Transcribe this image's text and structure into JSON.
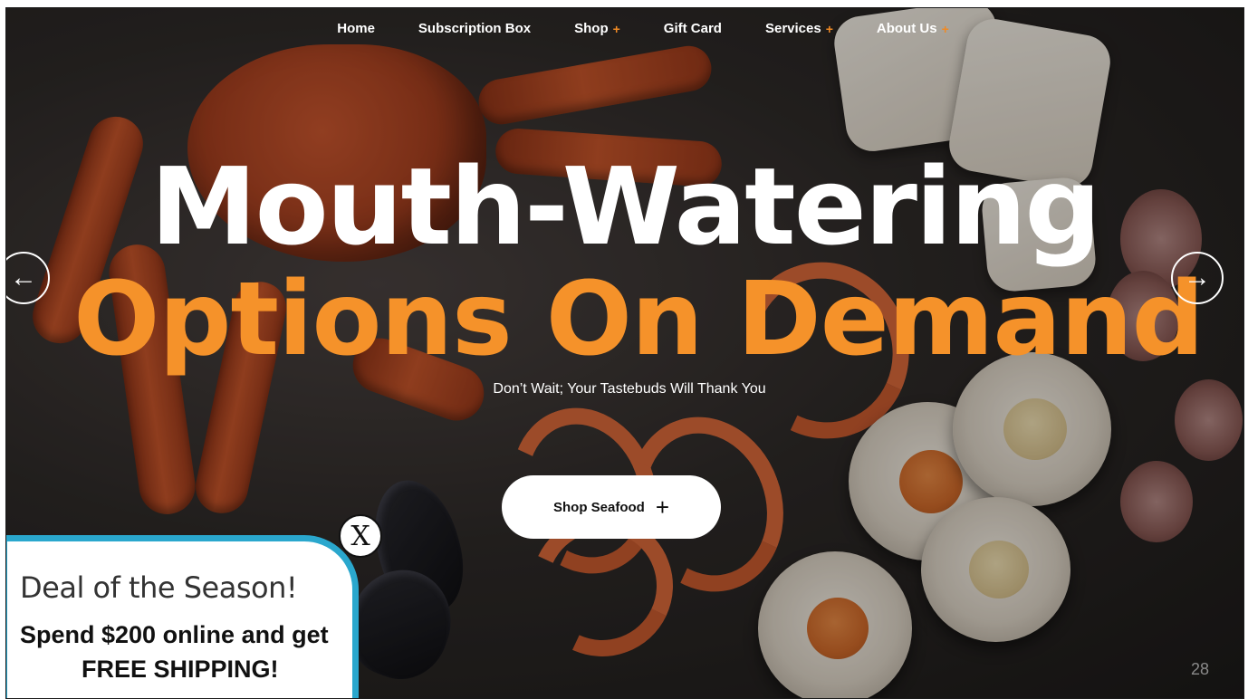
{
  "nav": {
    "items": [
      {
        "label": "Home",
        "has_submenu": false
      },
      {
        "label": "Subscription Box",
        "has_submenu": false
      },
      {
        "label": "Shop",
        "has_submenu": true
      },
      {
        "label": "Gift Card",
        "has_submenu": false
      },
      {
        "label": "Services",
        "has_submenu": true
      },
      {
        "label": "About Us",
        "has_submenu": true
      }
    ],
    "submenu_glyph": "+"
  },
  "hero": {
    "headline_line1": "Mouth-Watering",
    "headline_line2": "Options On Demand",
    "tagline": "Don’t Wait; Your Tastebuds Will Thank You",
    "cta_label": "Shop Seafood",
    "cta_icon": "+",
    "prev_arrow": "←",
    "next_arrow": "→"
  },
  "popup": {
    "title": "Deal of the Season!",
    "line1": "Spend $200 online and get",
    "line2": "FREE SHIPPING!",
    "close_label": "X"
  },
  "slide_number": "28",
  "colors": {
    "accent_orange": "#f5922a",
    "popup_border": "#2aa7cd",
    "text_white": "#ffffff"
  }
}
